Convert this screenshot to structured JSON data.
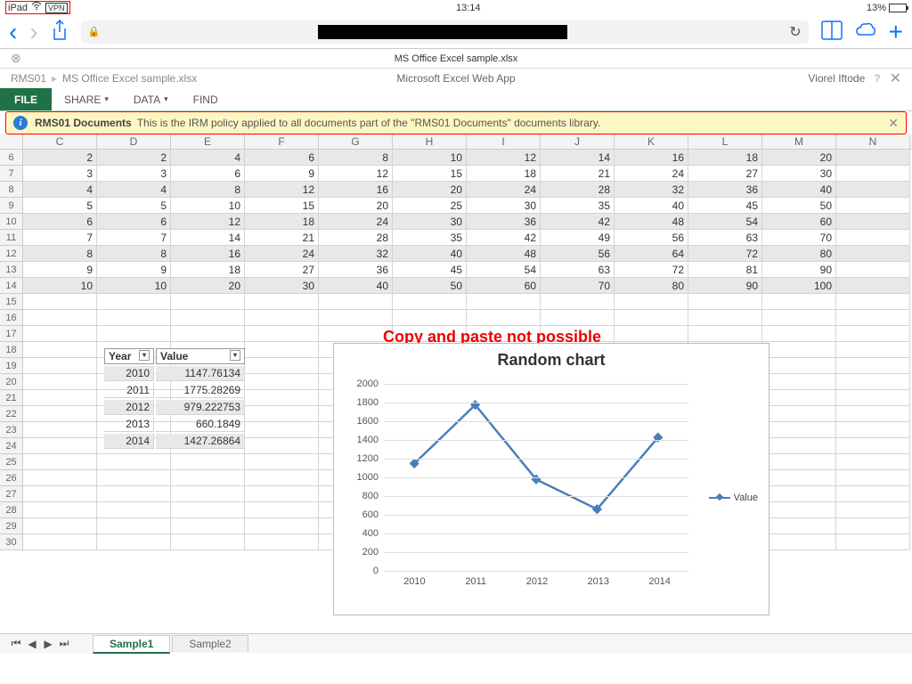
{
  "status": {
    "device": "iPad",
    "vpn": "VPN",
    "time": "13:14",
    "battery_pct": "13%"
  },
  "browser_tab": "MS Office Excel sample.xlsx",
  "breadcrumb": {
    "root": "RMS01",
    "file": "MS Office Excel sample.xlsx",
    "app": "Microsoft Excel Web App",
    "user": "Viorel Iftode"
  },
  "ribbon": {
    "file": "FILE",
    "share": "SHARE",
    "data": "DATA",
    "find": "FIND"
  },
  "notice": {
    "title": "RMS01 Documents",
    "body": "This is the IRM policy applied to all documents part of the \"RMS01 Documents\" documents library."
  },
  "annotation": "Copy and paste not possible",
  "columns": [
    "C",
    "D",
    "E",
    "F",
    "G",
    "H",
    "I",
    "J",
    "K",
    "L",
    "M",
    "N"
  ],
  "rows": [
    {
      "n": 6,
      "shaded": true,
      "v": [
        2,
        2,
        4,
        6,
        8,
        10,
        12,
        14,
        16,
        18,
        20
      ]
    },
    {
      "n": 7,
      "shaded": false,
      "v": [
        3,
        3,
        6,
        9,
        12,
        15,
        18,
        21,
        24,
        27,
        30
      ]
    },
    {
      "n": 8,
      "shaded": true,
      "v": [
        4,
        4,
        8,
        12,
        16,
        20,
        24,
        28,
        32,
        36,
        40
      ]
    },
    {
      "n": 9,
      "shaded": false,
      "v": [
        5,
        5,
        10,
        15,
        20,
        25,
        30,
        35,
        40,
        45,
        50
      ]
    },
    {
      "n": 10,
      "shaded": true,
      "v": [
        6,
        6,
        12,
        18,
        24,
        30,
        36,
        42,
        48,
        54,
        60
      ]
    },
    {
      "n": 11,
      "shaded": false,
      "v": [
        7,
        7,
        14,
        21,
        28,
        35,
        42,
        49,
        56,
        63,
        70
      ]
    },
    {
      "n": 12,
      "shaded": true,
      "v": [
        8,
        8,
        16,
        24,
        32,
        40,
        48,
        56,
        64,
        72,
        80
      ]
    },
    {
      "n": 13,
      "shaded": false,
      "v": [
        9,
        9,
        18,
        27,
        36,
        45,
        54,
        63,
        72,
        81,
        90
      ]
    },
    {
      "n": 14,
      "shaded": true,
      "v": [
        10,
        10,
        20,
        30,
        40,
        50,
        60,
        70,
        80,
        90,
        100
      ]
    }
  ],
  "blank_rows": [
    15,
    16,
    17,
    18,
    19,
    20,
    21,
    22,
    23,
    24,
    25,
    26,
    27,
    28,
    29,
    30
  ],
  "mini_table": {
    "headers": [
      "Year",
      "Value"
    ],
    "rows": [
      {
        "sh": true,
        "y": 2010,
        "v": "1147.76134"
      },
      {
        "sh": false,
        "y": 2011,
        "v": "1775.28269"
      },
      {
        "sh": true,
        "y": 2012,
        "v": "979.222753"
      },
      {
        "sh": false,
        "y": 2013,
        "v": "660.1849"
      },
      {
        "sh": true,
        "y": 2014,
        "v": "1427.26864"
      }
    ]
  },
  "chart_data": {
    "type": "line",
    "title": "Random chart",
    "xlabel": "",
    "ylabel": "",
    "categories": [
      2010,
      2011,
      2012,
      2013,
      2014
    ],
    "series": [
      {
        "name": "Value",
        "values": [
          1148,
          1775,
          979,
          660,
          1427
        ]
      }
    ],
    "ylim": [
      0,
      2000
    ],
    "ytick": 200
  },
  "sheet_tabs": {
    "active": "Sample1",
    "other": "Sample2"
  }
}
